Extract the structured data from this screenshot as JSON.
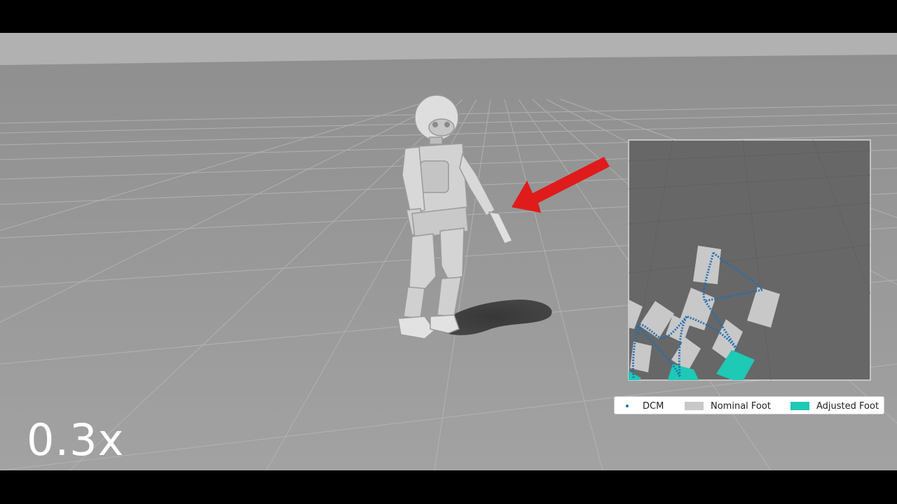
{
  "playback": {
    "speed_label": "0.3x"
  },
  "legend": {
    "items": [
      {
        "label": "DCM",
        "color": "#1f6fb4",
        "marker": "dot"
      },
      {
        "label": "Nominal Foot",
        "color": "#c8c8c8",
        "marker": "swatch"
      },
      {
        "label": "Adjusted Foot",
        "color": "#1ec9b6",
        "marker": "swatch"
      }
    ]
  },
  "colors": {
    "arrow": "#e01b1b",
    "floor": "#9a9a9a",
    "sky": "#b0b0b0",
    "robot": "#d4d4d4",
    "inset_bg": "#666666"
  },
  "icons": {
    "pointer": "red-arrow-icon"
  }
}
